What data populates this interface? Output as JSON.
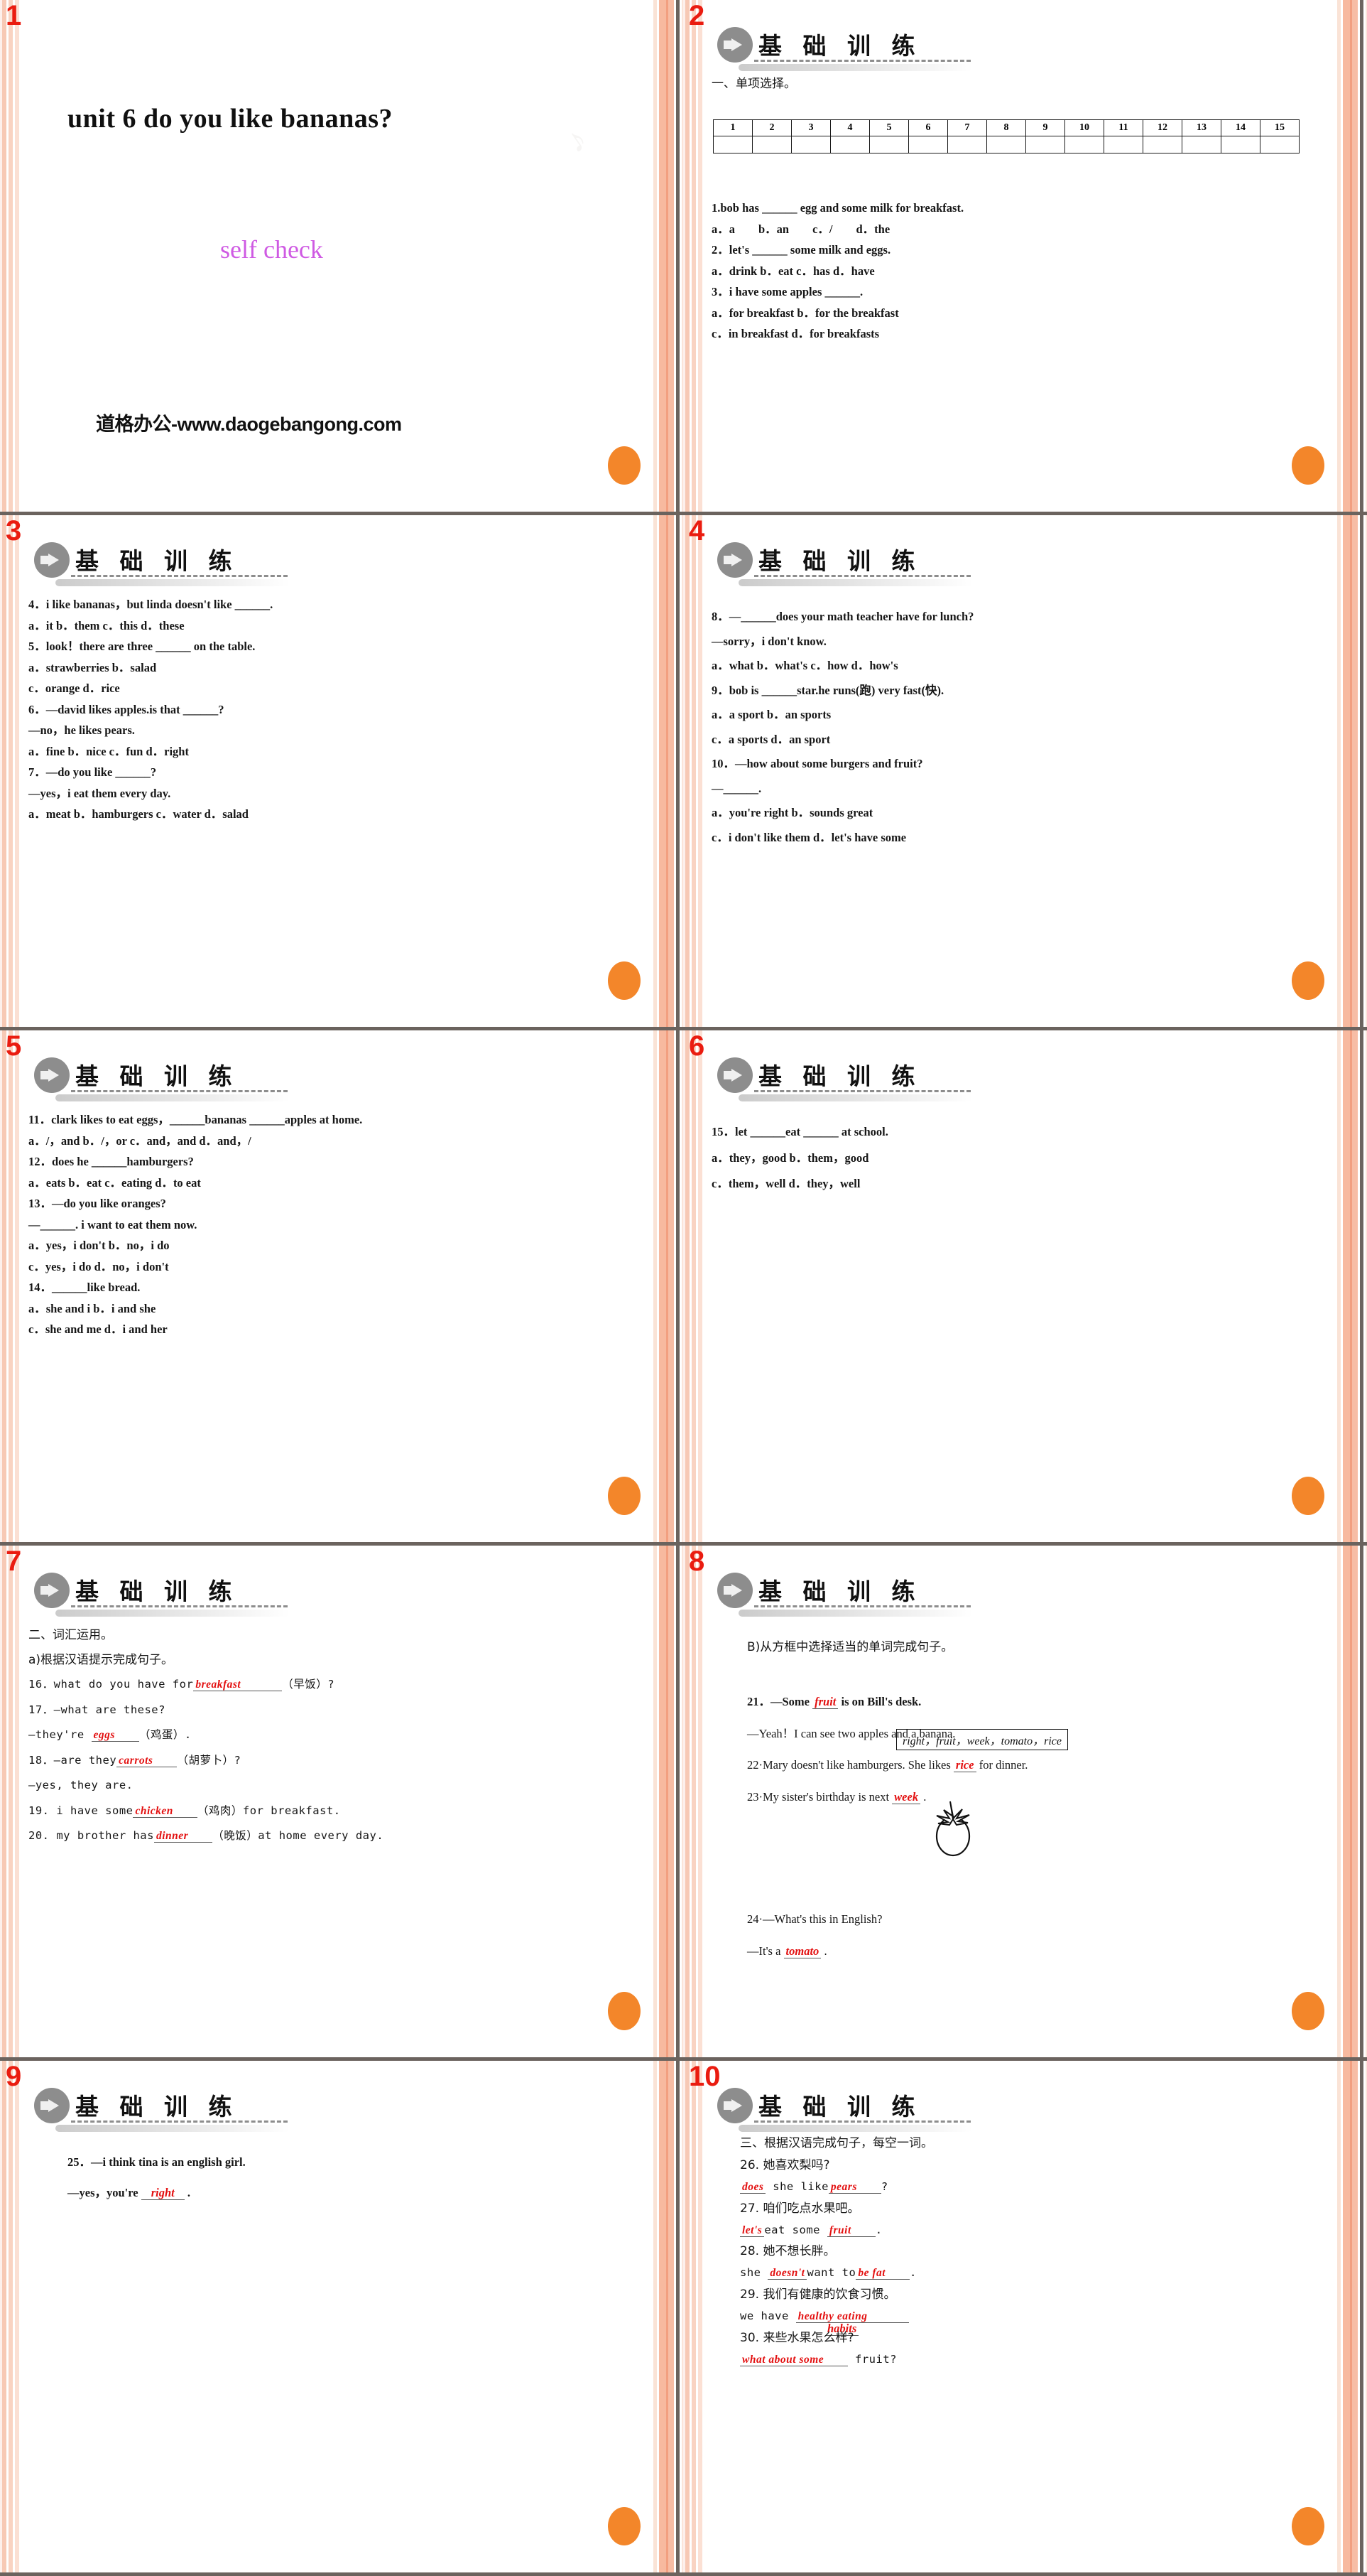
{
  "deck": {
    "slide_count": 10,
    "accent_red": "#ea1c10",
    "answer_red": "#e31010",
    "purple": "#cf5ae3",
    "orange": "#f3862a",
    "banner_cn": "基 础 训 练"
  },
  "slides": [
    {
      "number": "1",
      "title": "unit 6    do you like bananas?",
      "subtitle": "self check",
      "url": "道格办公-www.daogebangong.com"
    },
    {
      "number": "2",
      "section": "一、单项选择。",
      "table_headers": [
        "1",
        "2",
        "3",
        "4",
        "5",
        "6",
        "7",
        "8",
        "9",
        "10",
        "11",
        "12",
        "13",
        "14",
        "15"
      ],
      "lines": [
        "1.bob has ______ egg and some milk for breakfast.",
        "a．a　　b．an　　c．/　　d．the",
        "2．let's ______ some milk and eggs.",
        "a．drink b．eat c．has d．have",
        "3．i have some apples ______.",
        "a．for breakfast  b．for the breakfast",
        "c．in breakfast d．for breakfasts"
      ]
    },
    {
      "number": "3",
      "lines": [
        "4．i like bananas，but linda doesn't like ______.",
        "a．it b．them c．this d．these",
        "5．look！there are three ______ on the table.",
        "a．strawberries  b．salad",
        "c．orange d．rice",
        "6．—david likes apples.is that ______?",
        "—no，he likes pears.",
        "a．fine b．nice c．fun d．right",
        "7．—do you like ______?",
        "—yes，i eat them every day.",
        "a．meat b．hamburgers c．water d．salad"
      ]
    },
    {
      "number": "4",
      "lines": [
        "8．—______does your math teacher have for lunch?",
        "—sorry，i don't know.",
        "a．what b．what's c．how d．how's",
        "9．bob is ______star.he runs(跑) very fast(快).",
        "a．a sport b．an sports",
        "c．a sports d．an sport",
        "10．—how about some burgers and fruit?",
        "—______.",
        "a．you're right b．sounds great",
        "c．i don't like them d．let's have some"
      ]
    },
    {
      "number": "5",
      "lines": [
        "11．clark likes to eat eggs，______bananas ______apples at home.",
        "a．/，and b．/，or c．and，and d．and，/",
        "12．does he ______hamburgers?",
        "a．eats b．eat c．eating d．to eat",
        "13．—do you like oranges?",
        "—______. i want to eat them now.",
        "a．yes，i don't b．no，i do",
        "c．yes，i do d．no，i don't",
        "14．______like bread.",
        "a．she and i b．i and she",
        "c．she and me d．i and her"
      ]
    },
    {
      "number": "6",
      "lines": [
        "15．let ______eat ______ at school.",
        "a．they，good b．them，good",
        "c．them，well d．they，well"
      ]
    },
    {
      "number": "7",
      "section": "二、词汇运用。",
      "sub": "a)根据汉语提示完成句子。",
      "items": [
        {
          "pre": "16．what do you have for",
          "ans": "breakfast",
          "post": "（早饭）?"
        },
        {
          "pre": "17．—what are these?",
          "ans": "",
          "post": ""
        },
        {
          "pre": "—they're ",
          "ans": "eggs",
          "post": "（鸡蛋）."
        },
        {
          "pre": "18．—are they",
          "ans": "carrots",
          "post": "（胡萝卜）?"
        },
        {
          "pre": "—yes, they are.",
          "ans": "",
          "post": ""
        },
        {
          "pre": "19. i have some",
          "ans": "chicken",
          "post": "（鸡肉）for breakfast."
        },
        {
          "pre": "20. my brother has",
          "ans": "dinner",
          "post": "（晚饭）at home every day."
        }
      ]
    },
    {
      "number": "8",
      "sub": "B)从方框中选择适当的单词完成句子。",
      "wordbank": "right，fruit，week，tomato，rice",
      "items": [
        {
          "pre": "21．—Some",
          "ans": "fruit",
          "post": "is on Bill's desk."
        },
        {
          "pre": "—Yeah！I can see two apples and a banana.",
          "ans": "",
          "post": ""
        },
        {
          "pre": "22·Mary doesn't like hamburgers. She likes",
          "ans": "rice",
          "post": "for dinner."
        },
        {
          "pre": "23·My sister's birthday is next",
          "ans": "week",
          "post": "."
        },
        {
          "pre": "24·—What's this in English?",
          "ans": "",
          "post": ""
        },
        {
          "pre": "—It's a",
          "ans": "tomato",
          "post": "."
        }
      ]
    },
    {
      "number": "9",
      "items": [
        {
          "pre": "25．—i think tina is an english girl.",
          "ans": "",
          "post": ""
        },
        {
          "pre": "—yes，you're",
          "ans": "right",
          "post": "."
        }
      ]
    },
    {
      "number": "10",
      "section": "三、根据汉语完成句子，每空一词。",
      "items": [
        {
          "pre": "26. 她喜欢梨吗?",
          "ans": "",
          "post": ""
        },
        {
          "pre": "",
          "ans": "does",
          "mid": " she like",
          "ans2": "pears",
          "post": "?"
        },
        {
          "pre": "27. 咱们吃点水果吧。",
          "ans": "",
          "post": ""
        },
        {
          "pre": "",
          "ans": "let's",
          "mid": "eat some ",
          "ans2": "fruit",
          "post": "."
        },
        {
          "pre": "28. 她不想长胖。",
          "ans": "",
          "post": ""
        },
        {
          "pre": "she ",
          "ans": "doesn't",
          "mid": "want to",
          "ans2": "be fat",
          "post": "."
        },
        {
          "pre": "29. 我们有健康的饮食习惯。",
          "ans": "",
          "post": ""
        },
        {
          "pre": "we have ",
          "ans": "healthy eating",
          "mid": "",
          "ans2": "habits",
          "post": ""
        },
        {
          "pre": "30. 来些水果怎么样?",
          "ans": "",
          "post": ""
        },
        {
          "pre": "",
          "ans": "what about some",
          "mid": "",
          "ans2": "",
          "post": " fruit?"
        }
      ]
    }
  ]
}
